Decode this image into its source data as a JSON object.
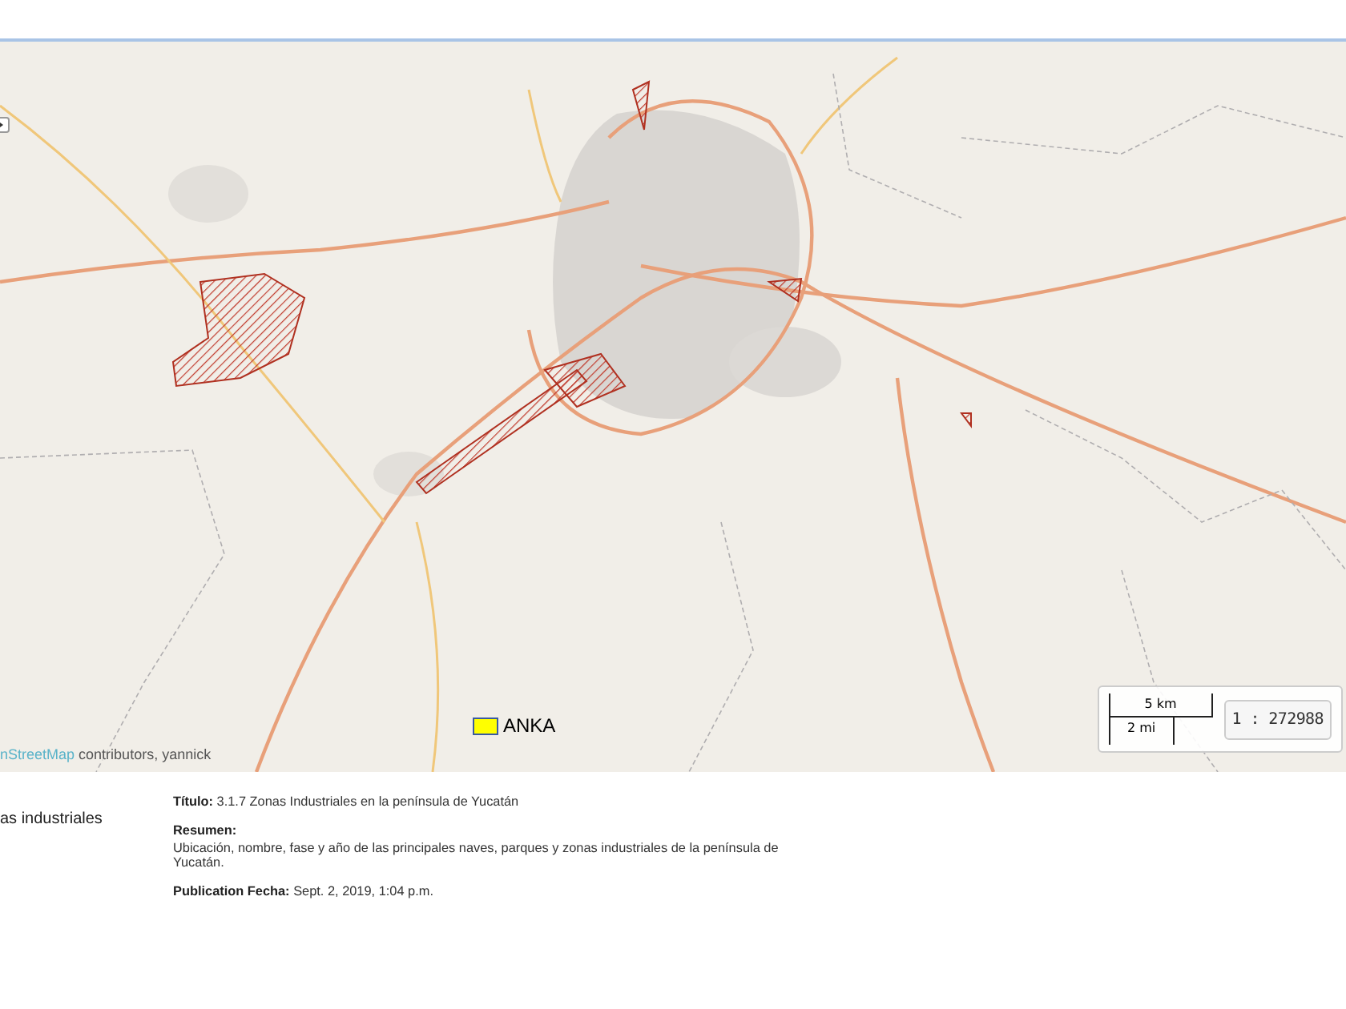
{
  "map": {
    "attribution": {
      "link": "nStreetMap",
      "text": "contributors, yannick"
    },
    "legend": {
      "label": "ANKA",
      "color": "#ffff00"
    },
    "scale": {
      "metric": "5 km",
      "imperial": "2 mi",
      "ratio": "1 : 272988"
    }
  },
  "sidebar": {
    "layer_name": "as industriales"
  },
  "details": [
    {
      "label": "Título:",
      "value": "3.1.7 Zonas Industriales en la península de Yucatán",
      "kind": "inline"
    },
    {
      "label": "Resumen:",
      "value": "Ubicación, nombre, fase y año de las principales naves, parques y zonas industriales de la península de Yucatán.",
      "kind": "block"
    },
    {
      "label": "Publication Fecha:",
      "value": "Sept. 2, 2019, 1:04 p.m.",
      "kind": "inline"
    }
  ]
}
